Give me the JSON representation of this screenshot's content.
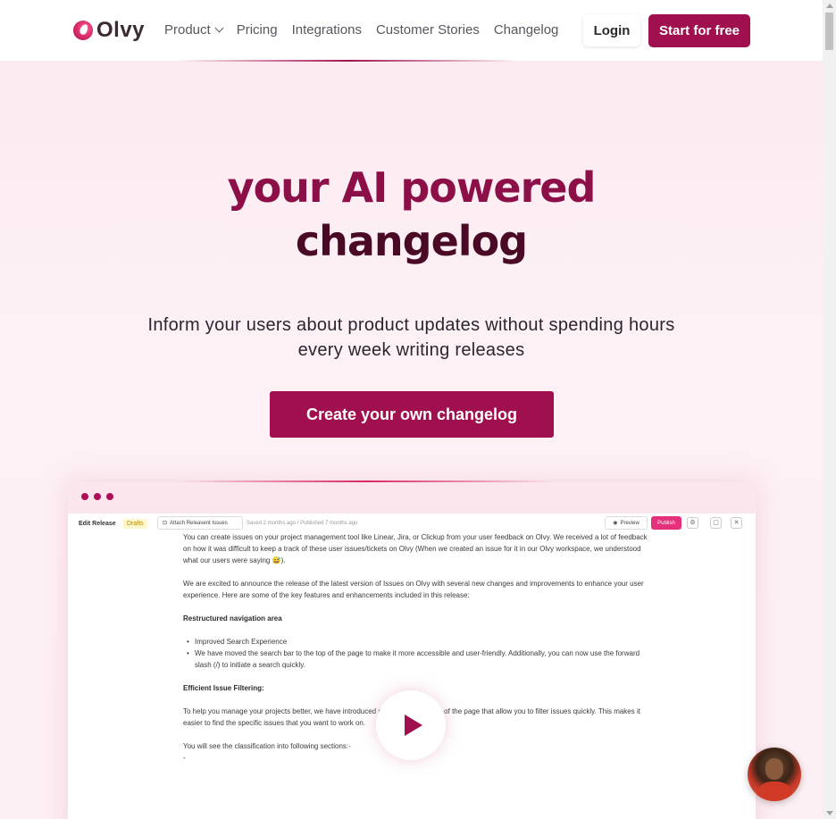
{
  "brand": {
    "name": "Olvy",
    "accent": "#a0104f",
    "accent_dark": "#4a0a26",
    "publish_pink": "#e5307b"
  },
  "nav": {
    "logo_text": "Olvy",
    "links": [
      "Product",
      "Pricing",
      "Integrations",
      "Customer Stories",
      "Changelog"
    ],
    "product_icon": "chevron-down-icon",
    "login_label": "Login",
    "start_label": "Start for free"
  },
  "hero": {
    "title_line1": "your AI powered",
    "title_line2": "changelog",
    "subtitle": "Inform your users about product updates without spending hours every week writing releases",
    "cta_label": "Create your own changelog"
  },
  "preview": {
    "window_dots": 3,
    "toolbar": {
      "title": "Edit Release",
      "status": "Drafts",
      "attach_label": "Attach Releavent Issues",
      "saved": "Saved 2 months ago",
      "published": "Published 7 months ago",
      "preview_label": "Preview",
      "publish_label": "Publish",
      "icons": [
        "settings-icon",
        "window-icon",
        "close-icon"
      ]
    },
    "document": {
      "para1": "You can create issues on your project management tool like Linear, Jira, or Clickup from your user feedback on Olvy. We received a lot of feedback on how it was difficult to keep a track of these user issues/tickets on Olvy (When we created an issue for it in our Olvy workspace, we understood what our users were saying 😅).",
      "para2": "We are excited to announce the release of the latest version of Issues on Olvy with several new changes and improvements to enhance your user experience. Here are some of the key features and enhancements included in this release:",
      "heading1": "Restructured navigation area",
      "bullets": [
        "Improved Search Experience",
        "We have moved the search bar to the top of the page to make it more accessible and user-friendly. Additionally, you can now use the forward slash (/) to initiate a search quickly."
      ],
      "heading2": "Efficient Issue Filtering:",
      "para3": "To help you manage your projects better, we have introduced new filters at the top of the page that allow you to filter issues quickly. This makes it easier to find the specific issues that you want to work on.",
      "para4": "You will see the classification into following sections:-",
      "trail": "-"
    },
    "play_icon": "play-icon"
  },
  "chat": {
    "avatar_icon": "support-avatar"
  }
}
